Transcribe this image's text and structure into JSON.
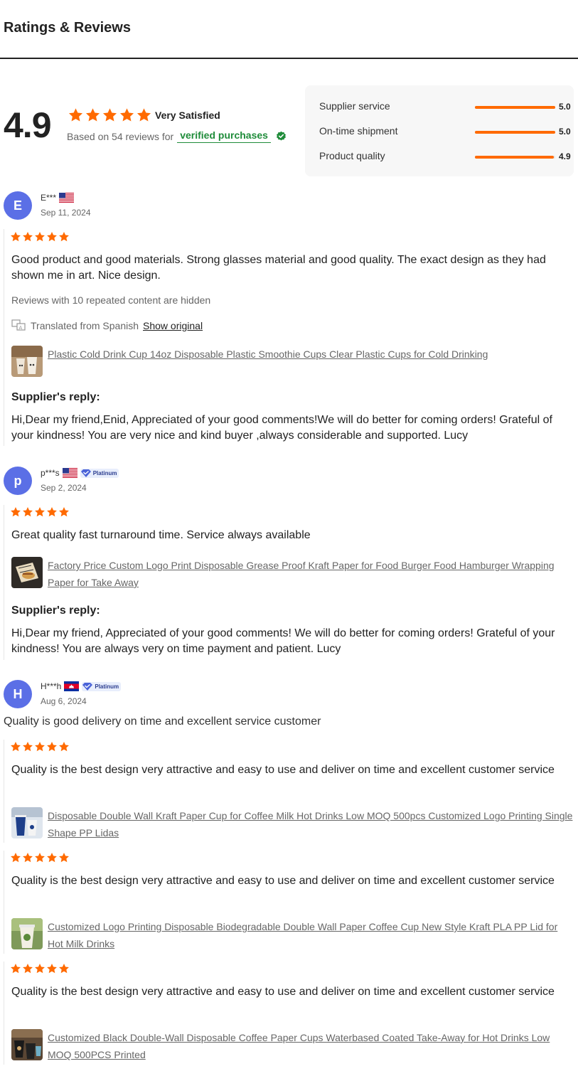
{
  "header": {
    "title": "Ratings & Reviews"
  },
  "summary": {
    "score": "4.9",
    "stars": 5,
    "satisfaction": "Very Satisfied",
    "based_on": "Based on 54 reviews for",
    "verified_label": "verified purchases",
    "colors": {
      "star": "#ff6a00",
      "verified": "#1f8c3a",
      "bar": "#ff6a00"
    }
  },
  "dimensions": [
    {
      "label": "Supplier service",
      "score": "5.0",
      "fraction": 1.0
    },
    {
      "label": "On-time shipment",
      "score": "5.0",
      "fraction": 1.0
    },
    {
      "label": "Product quality",
      "score": "4.9",
      "fraction": 0.98
    }
  ],
  "reviews": [
    {
      "initial": "E",
      "name": "E***",
      "flag": "us-flag-icon",
      "date": "Sep 11, 2024",
      "stars": 5,
      "text": "Good product and good materials. Strong glasses material and good quality. The exact design as they had shown me in art. Nice design.",
      "hidden_note": "Reviews with 10 repeated content are hidden",
      "translated_from": "Translated from Spanish",
      "show_original": "Show original",
      "product": "Plastic Cold Drink Cup 14oz Disposable Plastic Smoothie Cups Clear Plastic Cups for Cold Drinking",
      "reply_label": "Supplier's reply:",
      "reply": "Hi,Dear my friend,Enid, Appreciated of your good comments!We will do better for coming orders! Grateful of your kindness! You are very nice and kind buyer ,always considerable and supported. Lucy"
    },
    {
      "initial": "p",
      "name": "p***s",
      "flag": "us-flag-icon",
      "badge": "Platinum",
      "date": "Sep 2, 2024",
      "stars": 5,
      "text": "Great quality fast turnaround time. Service always available",
      "product": "Factory Price Custom Logo Print Disposable Grease Proof Kraft Paper for Food Burger Food Hamburger Wrapping Paper for Take Away",
      "reply_label": "Supplier's reply:",
      "reply": "Hi,Dear my friend, Appreciated of your good comments! We will do better for coming orders! Grateful of your kindness! You are always very on time payment and patient. Lucy"
    },
    {
      "initial": "H",
      "name": "H***h",
      "flag": "kh-flag-icon",
      "badge": "Platinum",
      "date": "Aug 6, 2024",
      "comment": "Quality is good delivery on time and excellent service customer",
      "items": [
        {
          "stars": 5,
          "text": "Quality is the best design very attractive and easy to use and deliver on time and excellent customer service",
          "product": "Disposable Double Wall Kraft Paper Cup for Coffee Milk Hot Drinks Low MOQ 500pcs Customized Logo Printing Single Shape PP Lidas"
        },
        {
          "stars": 5,
          "text": "Quality is the best design very attractive and easy to use and deliver on time and excellent customer service",
          "product": "Customized Logo Printing Disposable Biodegradable Double Wall Paper Coffee Cup New Style Kraft PLA PP Lid for Hot Milk Drinks"
        },
        {
          "stars": 5,
          "text": "Quality is the best design very attractive and easy to use and deliver on time and excellent customer service",
          "product": "Customized Black Double-Wall Disposable Coffee Paper Cups Waterbased Coated Take-Away for Hot Drinks Low MOQ 500PCS Printed"
        }
      ]
    }
  ]
}
